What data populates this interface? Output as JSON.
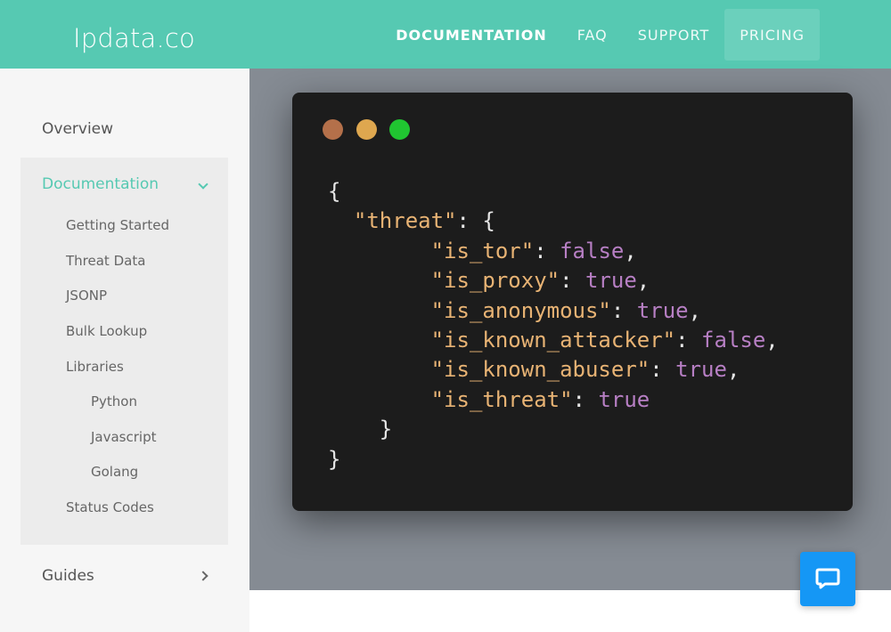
{
  "header": {
    "brand": "Ipdata.co",
    "nav": [
      {
        "label": "DOCUMENTATION",
        "active": true
      },
      {
        "label": "FAQ"
      },
      {
        "label": "SUPPORT"
      },
      {
        "label": "PRICING",
        "highlighted": true
      }
    ]
  },
  "sidebar": {
    "overview": "Overview",
    "documentation": {
      "title": "Documentation",
      "items": [
        {
          "label": "Getting Started"
        },
        {
          "label": "Threat Data"
        },
        {
          "label": "JSONP"
        },
        {
          "label": "Bulk Lookup"
        },
        {
          "label": "Libraries",
          "children": [
            {
              "label": "Python"
            },
            {
              "label": "Javascript"
            },
            {
              "label": "Golang"
            }
          ]
        },
        {
          "label": "Status Codes"
        }
      ]
    },
    "guides": "Guides"
  },
  "terminal": {
    "dots": [
      "#b4704a",
      "#dea74f",
      "#20c531"
    ],
    "code": {
      "open": "{",
      "object_key": "\"threat\"",
      "object_open": ": {",
      "entries": [
        {
          "key": "\"is_tor\"",
          "value": "false",
          "comma": ","
        },
        {
          "key": "\"is_proxy\"",
          "value": "true",
          "comma": ","
        },
        {
          "key": "\"is_anonymous\"",
          "value": "true",
          "comma": ","
        },
        {
          "key": "\"is_known_attacker\"",
          "value": "false",
          "comma": ","
        },
        {
          "key": "\"is_known_abuser\"",
          "value": "true",
          "comma": ","
        },
        {
          "key": "\"is_threat\"",
          "value": "true",
          "comma": ""
        }
      ],
      "inner_close": "}",
      "close": "}"
    }
  },
  "colors": {
    "brand": "#56c9b2",
    "hero_bg": "#858b93",
    "terminal_bg": "#1c1c1c",
    "code_key": "#e8b374",
    "code_value": "#b77fc4",
    "chat_button": "#1597f5"
  }
}
